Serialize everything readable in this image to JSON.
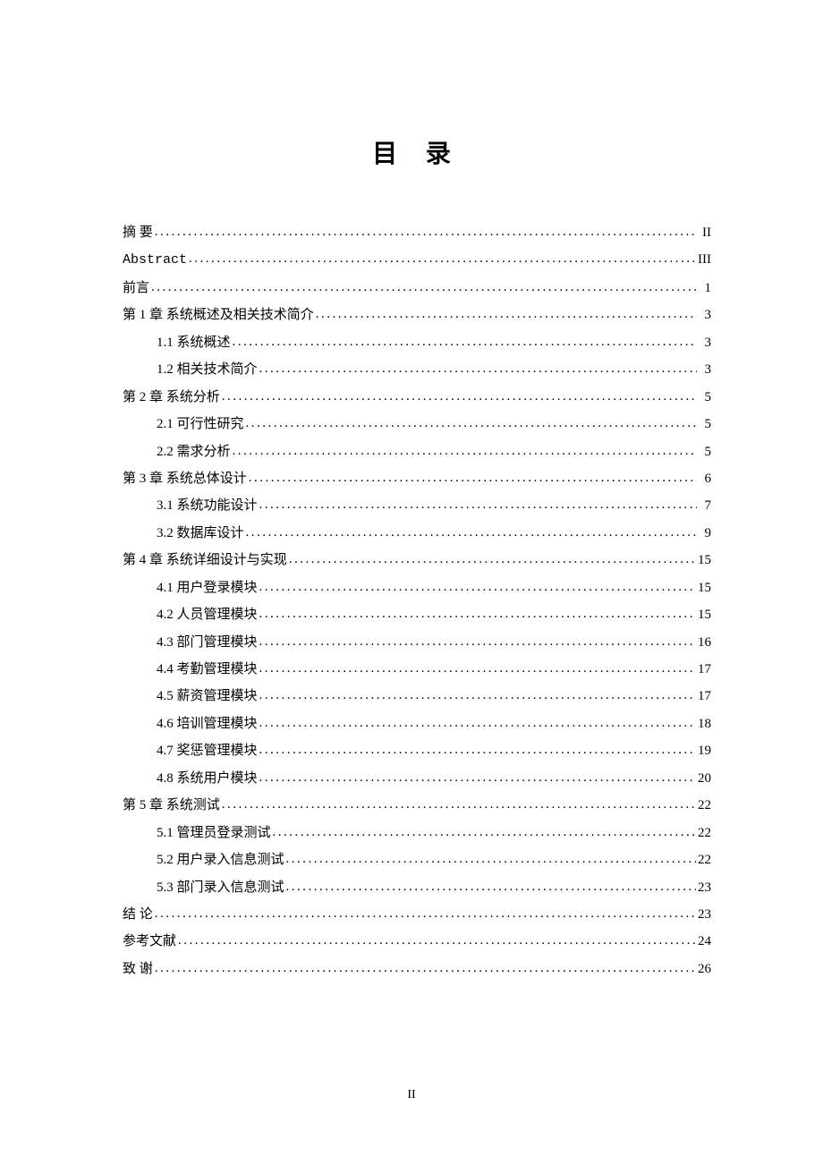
{
  "title": "目  录",
  "page_number": "II",
  "entries": [
    {
      "level": 1,
      "label": "摘   要",
      "page": "II",
      "cls": ""
    },
    {
      "level": 1,
      "label": "Abstract",
      "page": "III",
      "cls": "abstract-en"
    },
    {
      "level": 1,
      "label": "前言",
      "page": "1",
      "cls": ""
    },
    {
      "level": 1,
      "label": "第 1 章 系统概述及相关技术简介",
      "page": "3",
      "cls": ""
    },
    {
      "level": 2,
      "label": "1.1 系统概述",
      "page": "3",
      "cls": ""
    },
    {
      "level": 2,
      "label": "1.2 相关技术简介",
      "page": "3",
      "cls": ""
    },
    {
      "level": 1,
      "label": "第 2 章 系统分析",
      "page": "5",
      "cls": ""
    },
    {
      "level": 2,
      "label": "2.1 可行性研究",
      "page": "5",
      "cls": ""
    },
    {
      "level": 2,
      "label": "2.2 需求分析",
      "page": "5",
      "cls": ""
    },
    {
      "level": 1,
      "label": "第 3 章 系统总体设计",
      "page": "6",
      "cls": ""
    },
    {
      "level": 2,
      "label": "3.1 系统功能设计",
      "page": "7",
      "cls": ""
    },
    {
      "level": 2,
      "label": "3.2 数据库设计",
      "page": "9",
      "cls": ""
    },
    {
      "level": 1,
      "label": "第 4 章 系统详细设计与实现",
      "page": "15",
      "cls": ""
    },
    {
      "level": 2,
      "label": "4.1 用户登录模块",
      "page": "15",
      "cls": ""
    },
    {
      "level": 2,
      "label": "4.2 人员管理模块",
      "page": "15",
      "cls": ""
    },
    {
      "level": 2,
      "label": "4.3 部门管理模块",
      "page": "16",
      "cls": ""
    },
    {
      "level": 2,
      "label": "4.4 考勤管理模块",
      "page": "17",
      "cls": ""
    },
    {
      "level": 2,
      "label": "4.5 薪资管理模块",
      "page": "17",
      "cls": ""
    },
    {
      "level": 2,
      "label": "4.6 培训管理模块",
      "page": "18",
      "cls": ""
    },
    {
      "level": 2,
      "label": "4.7 奖惩管理模块",
      "page": "19",
      "cls": ""
    },
    {
      "level": 2,
      "label": "4.8 系统用户模块",
      "page": "20",
      "cls": ""
    },
    {
      "level": 1,
      "label": "第 5 章 系统测试",
      "page": "22",
      "cls": ""
    },
    {
      "level": 2,
      "label": "5.1 管理员登录测试",
      "page": "22",
      "cls": ""
    },
    {
      "level": 2,
      "label": "5.2 用户录入信息测试",
      "page": "22",
      "cls": ""
    },
    {
      "level": 2,
      "label": "5.3 部门录入信息测试",
      "page": "23",
      "cls": ""
    },
    {
      "level": 1,
      "label": "结   论",
      "page": "23",
      "cls": ""
    },
    {
      "level": 1,
      "label": "参考文献",
      "page": "24",
      "cls": ""
    },
    {
      "level": 1,
      "label": "致   谢",
      "page": "26",
      "cls": ""
    }
  ]
}
